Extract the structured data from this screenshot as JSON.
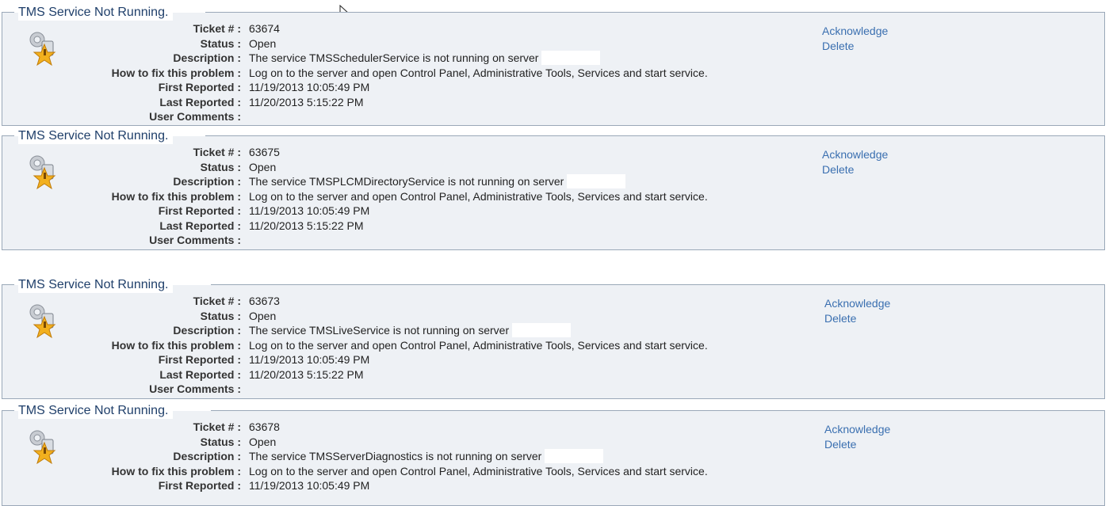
{
  "labels": {
    "ticket": "Ticket # :",
    "status": "Status :",
    "description": "Description :",
    "how_to_fix": "How to fix this problem :",
    "first_reported": "First Reported :",
    "last_reported": "Last Reported :",
    "user_comments": "User Comments :"
  },
  "actions": {
    "acknowledge": "Acknowledge",
    "delete": "Delete"
  },
  "tickets": [
    {
      "title": "TMS Service Not Running.",
      "ticket_number": "63674",
      "status": "Open",
      "description": "The service TMSSchedulerService is not running on server",
      "how_to_fix": "Log on to the server and open Control Panel, Administrative Tools, Services and start service.",
      "first_reported": "11/19/2013 10:05:49 PM",
      "last_reported": "11/20/2013 5:15:22 PM",
      "user_comments": ""
    },
    {
      "title": "TMS Service Not Running.",
      "ticket_number": "63675",
      "status": "Open",
      "description": "The service TMSPLCMDirectoryService is not running on server",
      "how_to_fix": "Log on to the server and open Control Panel, Administrative Tools, Services and start service.",
      "first_reported": "11/19/2013 10:05:49 PM",
      "last_reported": "11/20/2013 5:15:22 PM",
      "user_comments": ""
    },
    {
      "title": "TMS Service Not Running.",
      "ticket_number": "63673",
      "status": "Open",
      "description": "The service TMSLiveService is not running on server",
      "how_to_fix": "Log on to the server and open Control Panel, Administrative Tools, Services and start service.",
      "first_reported": "11/19/2013 10:05:49 PM",
      "last_reported": "11/20/2013 5:15:22 PM",
      "user_comments": ""
    },
    {
      "title": "TMS Service Not Running.",
      "ticket_number": "63678",
      "status": "Open",
      "description": "The service TMSServerDiagnostics is not running on server",
      "how_to_fix": "Log on to the server and open Control Panel, Administrative Tools, Services and start service.",
      "first_reported": "11/19/2013 10:05:49 PM",
      "last_reported": "",
      "user_comments": ""
    }
  ]
}
